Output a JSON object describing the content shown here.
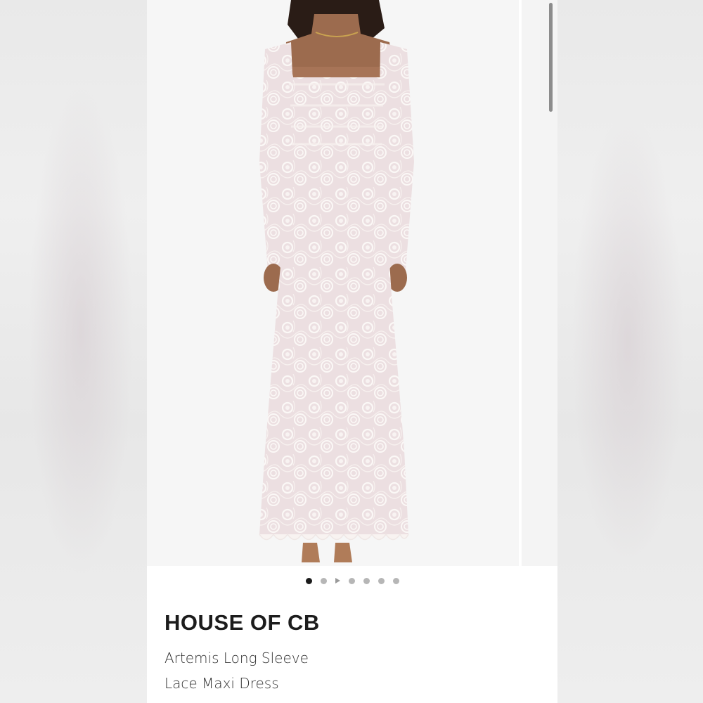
{
  "product": {
    "brand": "HOUSE OF CB",
    "title_line1": "Artemis Long Sleeve",
    "title_line2": "Lace Maxi Dress",
    "image_semantic": "lace-maxi-dress-photo"
  },
  "carousel": {
    "dot_count": 7,
    "active_index": 0,
    "video_dot_index": 2
  },
  "colors": {
    "page_bg": "#ececec",
    "screen_bg": "#ffffff",
    "dress": "#ece0e2",
    "lace": "#fbf8f6",
    "active_dot": "#1a1a1a",
    "inactive_dot": "#b6b6b6"
  }
}
